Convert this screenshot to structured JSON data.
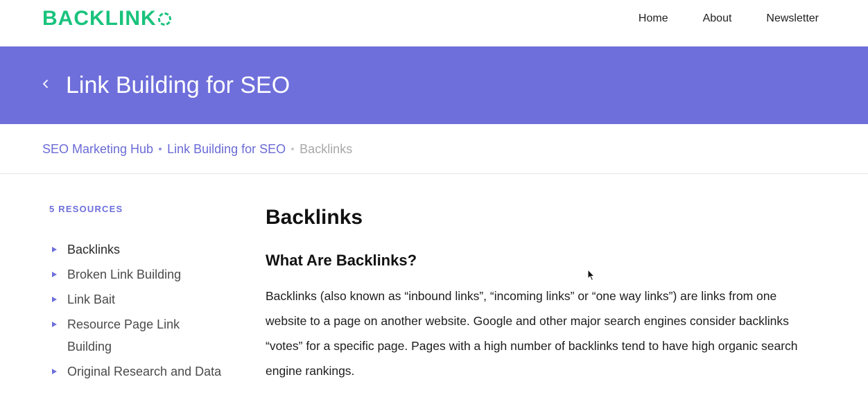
{
  "header": {
    "logo_text": "BACKLINK",
    "brand_color": "#19c37d",
    "nav": [
      {
        "label": "Home"
      },
      {
        "label": "About"
      },
      {
        "label": "Newsletter"
      }
    ]
  },
  "banner": {
    "title": "Link Building for SEO",
    "background": "#6e6fdb",
    "back_icon": "chevron-left-icon"
  },
  "breadcrumb": {
    "items": [
      "SEO Marketing Hub",
      "Link Building for SEO"
    ],
    "current": "Backlinks"
  },
  "sidebar": {
    "heading": "5 RESOURCES",
    "items": [
      {
        "label": "Backlinks"
      },
      {
        "label": "Broken Link Building"
      },
      {
        "label": "Link Bait"
      },
      {
        "label": "Resource Page Link Building"
      },
      {
        "label": "Original Research and Data"
      }
    ]
  },
  "article": {
    "title": "Backlinks",
    "subtitle": "What Are Backlinks?",
    "paragraph": "Backlinks (also known as “inbound links”, “incoming links” or “one way links”) are links from one website to a page on another website. Google and other major search engines consider backlinks “votes” for a specific page. Pages with a high number of backlinks tend to have high organic search engine rankings."
  }
}
